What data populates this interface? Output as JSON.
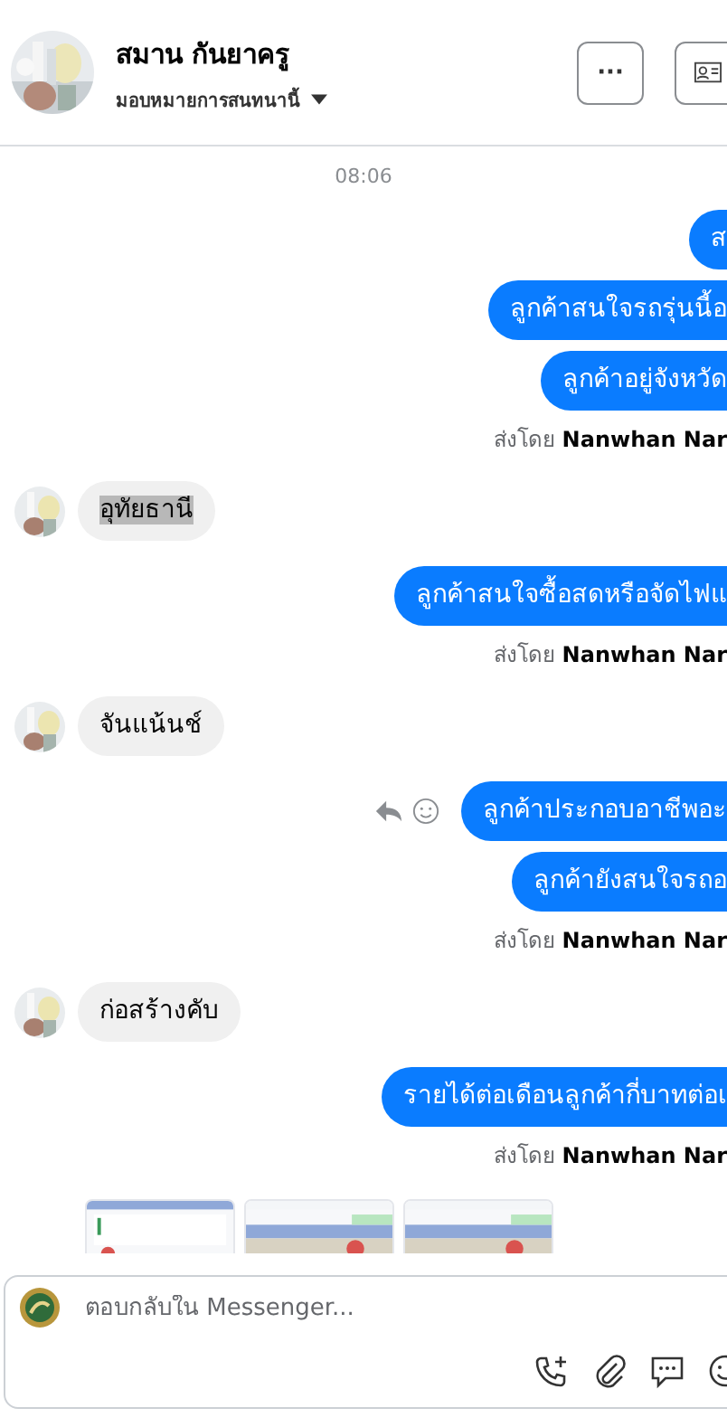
{
  "header": {
    "name": "สมาน กันยาครู",
    "assign_label": "มอบหมายการสนทนานี้",
    "more_label": "···"
  },
  "messages": [
    {
      "kind": "time",
      "text": "08:06"
    },
    {
      "kind": "out",
      "text": "ส",
      "show_actions": false
    },
    {
      "kind": "out",
      "text": "ลูกค้าสนใจรถรุ่นนี้อ",
      "show_actions": false
    },
    {
      "kind": "out",
      "text": "ลูกค้าอยู่จังหวัด",
      "show_actions": false
    },
    {
      "kind": "sent_by",
      "text": "ส่งโดย **Nanwhan Nar**"
    },
    {
      "kind": "in",
      "text": "อุทัยธานี",
      "highlighted": true
    },
    {
      "kind": "out",
      "text": "ลูกค้าสนใจซื้อสดหรือจัดไฟแ",
      "show_actions": false
    },
    {
      "kind": "sent_by",
      "text": "ส่งโดย **Nanwhan Nar**"
    },
    {
      "kind": "in",
      "text": "จันแน้นช์",
      "highlighted": false
    },
    {
      "kind": "out",
      "text": "ลูกค้าประกอบอาชีพอะ",
      "show_actions": true
    },
    {
      "kind": "out",
      "text": "ลูกค้ายังสนใจรถอ",
      "show_actions": false
    },
    {
      "kind": "sent_by",
      "text": "ส่งโดย **Nanwhan Nar**"
    },
    {
      "kind": "in",
      "text": "ก่อสร้างคับ",
      "highlighted": false
    },
    {
      "kind": "out",
      "text": "รายได้ต่อเดือนลูกค้ากี่บาทต่อเ",
      "show_actions": false
    },
    {
      "kind": "sent_by",
      "text": "ส่งโดย **Nanwhan Nar**"
    },
    {
      "kind": "images"
    }
  ],
  "composer": {
    "placeholder": "ตอบกลับใน Messenger..."
  }
}
